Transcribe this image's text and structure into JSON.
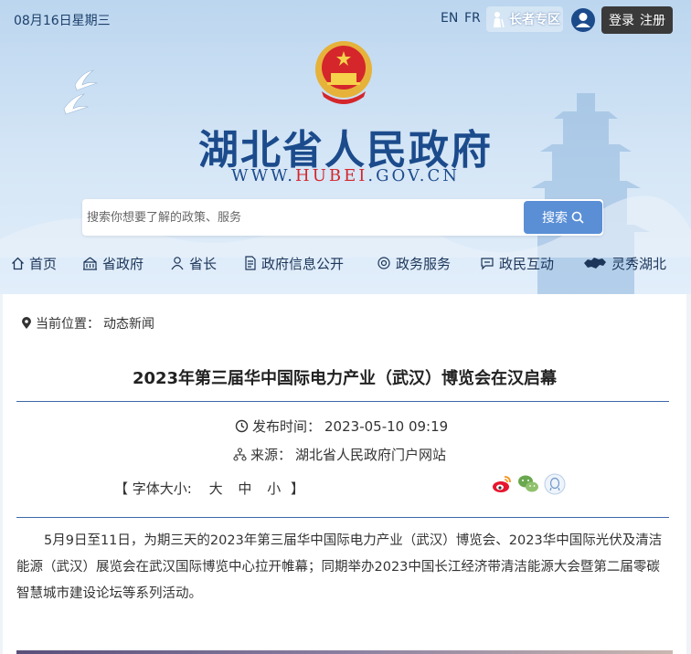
{
  "header": {
    "date": "08月16日星期三",
    "lang_en": "EN",
    "lang_fr": "FR",
    "elder_zone": "长者专区",
    "login": "登录",
    "register": "注册",
    "site_title": "湖北省人民政府",
    "url_prefix": "WWW.",
    "url_mid": "HUBEI",
    "url_suffix": ".GOV.CN"
  },
  "search": {
    "placeholder": "搜索你想要了解的政策、服务",
    "button": "搜索"
  },
  "nav": {
    "items": [
      {
        "label": "首页",
        "icon": "home-icon"
      },
      {
        "label": "省政府",
        "icon": "building-icon"
      },
      {
        "label": "省长",
        "icon": "person-icon"
      },
      {
        "label": "政府信息公开",
        "icon": "document-icon"
      },
      {
        "label": "政务服务",
        "icon": "service-icon"
      },
      {
        "label": "政民互动",
        "icon": "chat-icon"
      },
      {
        "label": "灵秀湖北",
        "icon": "hubei-map-icon"
      }
    ]
  },
  "breadcrumb": {
    "prefix": "当前位置：",
    "current": "动态新闻"
  },
  "article": {
    "title": "2023年第三届华中国际电力产业（武汉）博览会在汉启幕",
    "publish_label": "发布时间：",
    "publish_time": "2023-05-10 09:19",
    "source_label": "来源：",
    "source": "湖北省人民政府门户网站",
    "font_size_open": "【 字体大小:",
    "font_large": "大",
    "font_medium": "中",
    "font_small": "小",
    "font_size_close": "】",
    "body": "5月9日至11日，为期三天的2023年第三届华中国际电力产业（武汉）博览会、2023华中国际光伏及清洁能源（武汉）展览会在武汉国际博览中心拉开帷幕；同期举办2023中国长江经济带清洁能源大会暨第二届零碳智慧城市建设论坛等系列活动。"
  },
  "colors": {
    "primary": "#1c4b8c",
    "search_button": "#5a8fd6",
    "rule": "#3b67a8",
    "login_bg": "#3a3a3a"
  }
}
